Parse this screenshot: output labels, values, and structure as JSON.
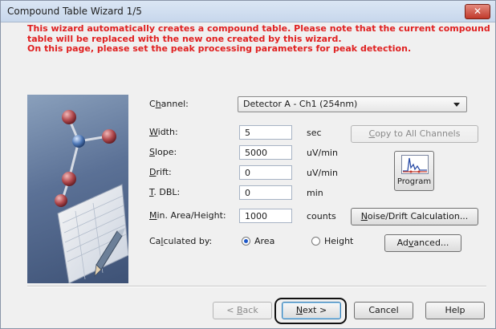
{
  "window": {
    "title": "Compound Table Wizard 1/5",
    "close_glyph": "✕"
  },
  "message": {
    "lines": [
      "This wizard automatically creates a compound table. Please note that the current compound",
      "table will be replaced with the new one created by this wizard.",
      "On this page, please set the peak processing parameters for peak detection."
    ]
  },
  "channel": {
    "label_pre": "C",
    "label_u": "h",
    "label_post": "annel:",
    "value": "Detector A - Ch1 (254nm)"
  },
  "params": {
    "width": {
      "label_u": "W",
      "label_post": "idth:",
      "value": "5",
      "unit": "sec"
    },
    "slope": {
      "label_u": "S",
      "label_post": "lope:",
      "value": "5000",
      "unit": "uV/min"
    },
    "drift": {
      "label_u": "D",
      "label_post": "rift:",
      "value": "0",
      "unit": "uV/min"
    },
    "tdbl": {
      "label_u": "T",
      "label_post": ". DBL:",
      "value": "0",
      "unit": "min"
    },
    "min_area": {
      "label_u": "M",
      "label_post": "in. Area/Height:",
      "value": "1000",
      "unit": "counts"
    }
  },
  "calculated_by": {
    "label_pre": "Ca",
    "label_u": "l",
    "label_post": "culated by:",
    "options": [
      "Area",
      "Height"
    ],
    "selected": "Area"
  },
  "buttons": {
    "copy": {
      "label_u": "C",
      "label_post": "opy to All Channels"
    },
    "program": "Program",
    "noise": {
      "label_u": "N",
      "label_post": "oise/Drift Calculation..."
    },
    "advanced": {
      "label_pre": "Ad",
      "label_u": "v",
      "label_post": "anced..."
    },
    "back": {
      "label_pre": "< ",
      "label_u": "B",
      "label_post": "ack"
    },
    "next": {
      "label_u": "N",
      "label_post": "ext >"
    },
    "cancel": "Cancel",
    "help": "Help"
  },
  "colors": {
    "warning_text": "#e02020",
    "radio_selected": "#1c56c7",
    "highlight_ring": "#111111"
  }
}
